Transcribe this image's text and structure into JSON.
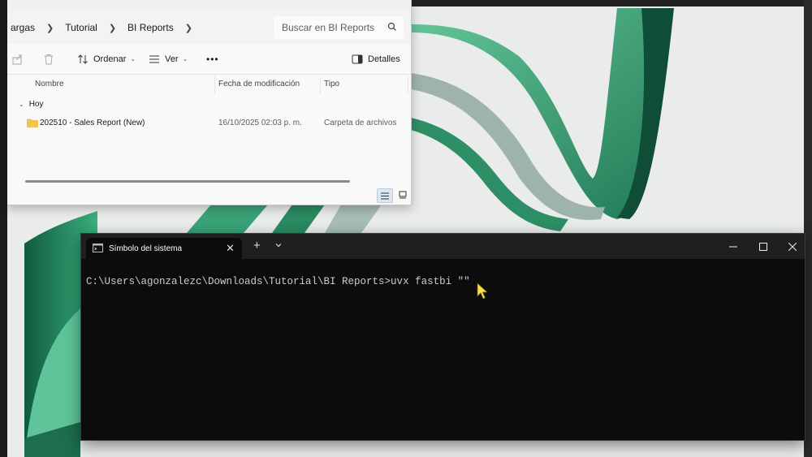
{
  "explorer": {
    "breadcrumbs": [
      "argas",
      "Tutorial",
      "BI Reports"
    ],
    "search_placeholder": "Buscar en BI Reports",
    "toolbar": {
      "sort_label": "Ordenar",
      "view_label": "Ver",
      "more_label": "•••",
      "details_label": "Detalles"
    },
    "columns": [
      "Nombre",
      "Fecha de modificación",
      "Tipo"
    ],
    "group_label": "Hoy",
    "files": [
      {
        "name": "202510 - Sales Report (New)",
        "date": "16/10/2025 02:03 p. m.",
        "type": "Carpeta de archivos"
      }
    ]
  },
  "terminal": {
    "tab_title": "Símbolo del sistema",
    "new_tab_label": "+",
    "minimize_label": "—",
    "close_label": "✕",
    "command_line": "C:\\Users\\agonzalezc\\Downloads\\Tutorial\\BI Reports>uvx fastbi \"\""
  },
  "colors": {
    "terminal_bg": "#0c0c0c",
    "terminal_titlebar": "#1f1f1f",
    "explorer_bg": "#f9f9f9",
    "wallpaper_green": "#2e9a6e",
    "cursor_yellow": "#f5e14b"
  }
}
